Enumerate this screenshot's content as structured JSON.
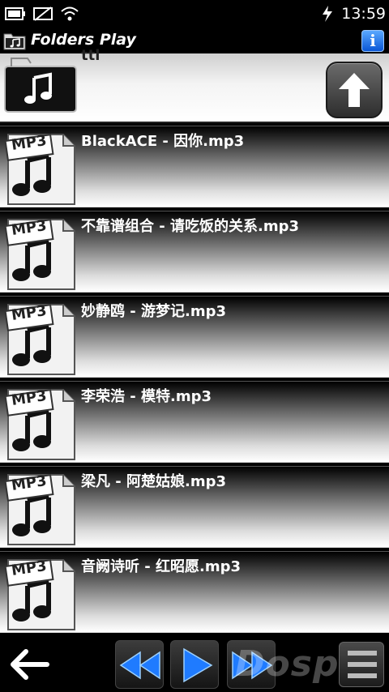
{
  "status": {
    "time": "13:59"
  },
  "app": {
    "title": "Folders Play",
    "info_label": "i"
  },
  "folder": {
    "name": "ttl"
  },
  "songs": [
    {
      "title": "BlackACE - 因你.mp3",
      "badge": "MP3"
    },
    {
      "title": "不靠谱组合 - 请吃饭的关系.mp3",
      "badge": "MP3"
    },
    {
      "title": "妙静鸥 - 游梦记.mp3",
      "badge": "MP3"
    },
    {
      "title": "李荣浩 - 模特.mp3",
      "badge": "MP3"
    },
    {
      "title": "梁凡 - 阿楚姑娘.mp3",
      "badge": "MP3"
    },
    {
      "title": "音阙诗听 - 红昭愿.mp3",
      "badge": "MP3"
    }
  ],
  "watermark": "Dospy",
  "colors": {
    "accent": "#1f7bff",
    "info_blue": "#0a57d6"
  },
  "icons": {
    "back": "left-arrow-icon",
    "rewind": "rewind-icon",
    "play": "play-icon",
    "forward": "fast-forward-icon",
    "up": "up-arrow-icon",
    "menu": "menu-icon"
  }
}
